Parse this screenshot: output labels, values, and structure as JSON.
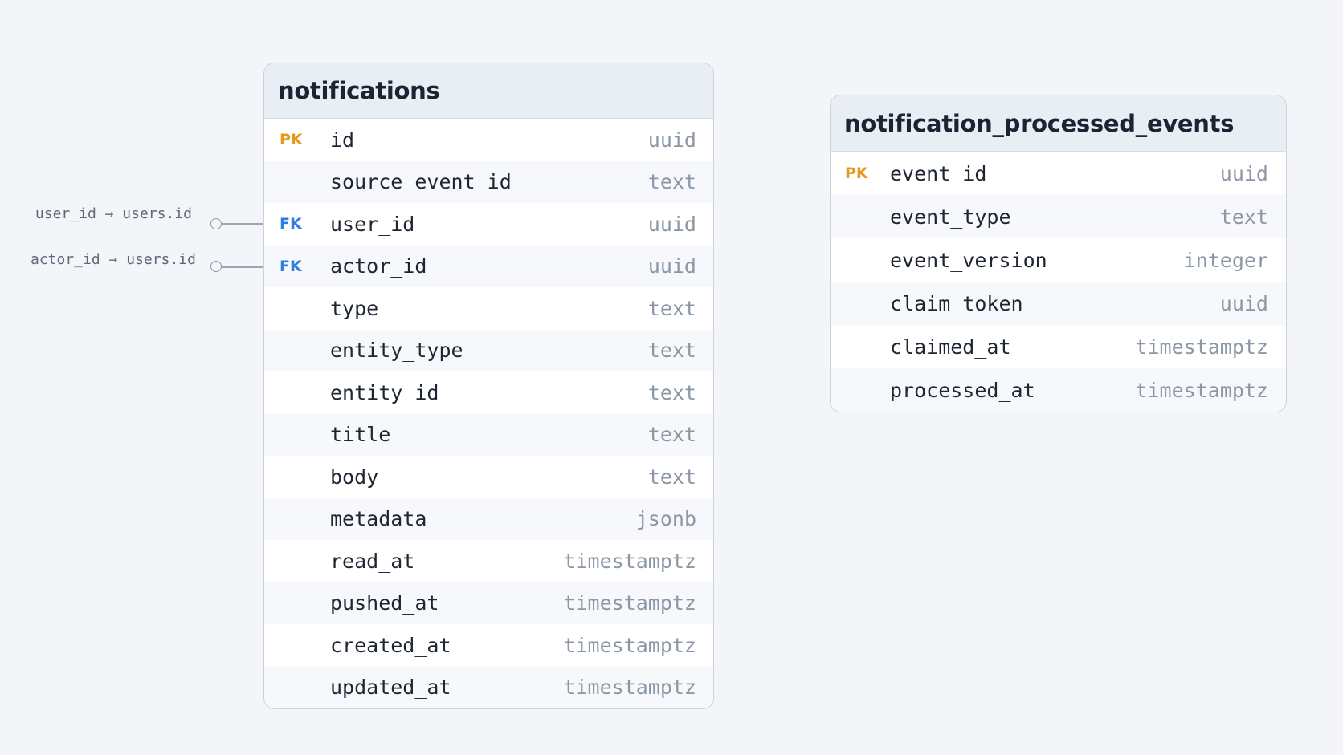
{
  "tables": [
    {
      "name": "notifications",
      "columns": [
        {
          "key": "PK",
          "name": "id",
          "type": "uuid"
        },
        {
          "key": "",
          "name": "source_event_id",
          "type": "text"
        },
        {
          "key": "FK",
          "name": "user_id",
          "type": "uuid"
        },
        {
          "key": "FK",
          "name": "actor_id",
          "type": "uuid"
        },
        {
          "key": "",
          "name": "type",
          "type": "text"
        },
        {
          "key": "",
          "name": "entity_type",
          "type": "text"
        },
        {
          "key": "",
          "name": "entity_id",
          "type": "text"
        },
        {
          "key": "",
          "name": "title",
          "type": "text"
        },
        {
          "key": "",
          "name": "body",
          "type": "text"
        },
        {
          "key": "",
          "name": "metadata",
          "type": "jsonb"
        },
        {
          "key": "",
          "name": "read_at",
          "type": "timestamptz"
        },
        {
          "key": "",
          "name": "pushed_at",
          "type": "timestamptz"
        },
        {
          "key": "",
          "name": "created_at",
          "type": "timestamptz"
        },
        {
          "key": "",
          "name": "updated_at",
          "type": "timestamptz"
        }
      ]
    },
    {
      "name": "notification_processed_events",
      "columns": [
        {
          "key": "PK",
          "name": "event_id",
          "type": "uuid"
        },
        {
          "key": "",
          "name": "event_type",
          "type": "text"
        },
        {
          "key": "",
          "name": "event_version",
          "type": "integer"
        },
        {
          "key": "",
          "name": "claim_token",
          "type": "uuid"
        },
        {
          "key": "",
          "name": "claimed_at",
          "type": "timestamptz"
        },
        {
          "key": "",
          "name": "processed_at",
          "type": "timestamptz"
        }
      ]
    }
  ],
  "references": [
    {
      "label": "user_id → users.id"
    },
    {
      "label": "actor_id → users.id"
    }
  ],
  "colors": {
    "pk": "#e39a1f",
    "fk": "#2f7de0",
    "header_bg": "#e9eef5",
    "border": "#c9d2de"
  }
}
